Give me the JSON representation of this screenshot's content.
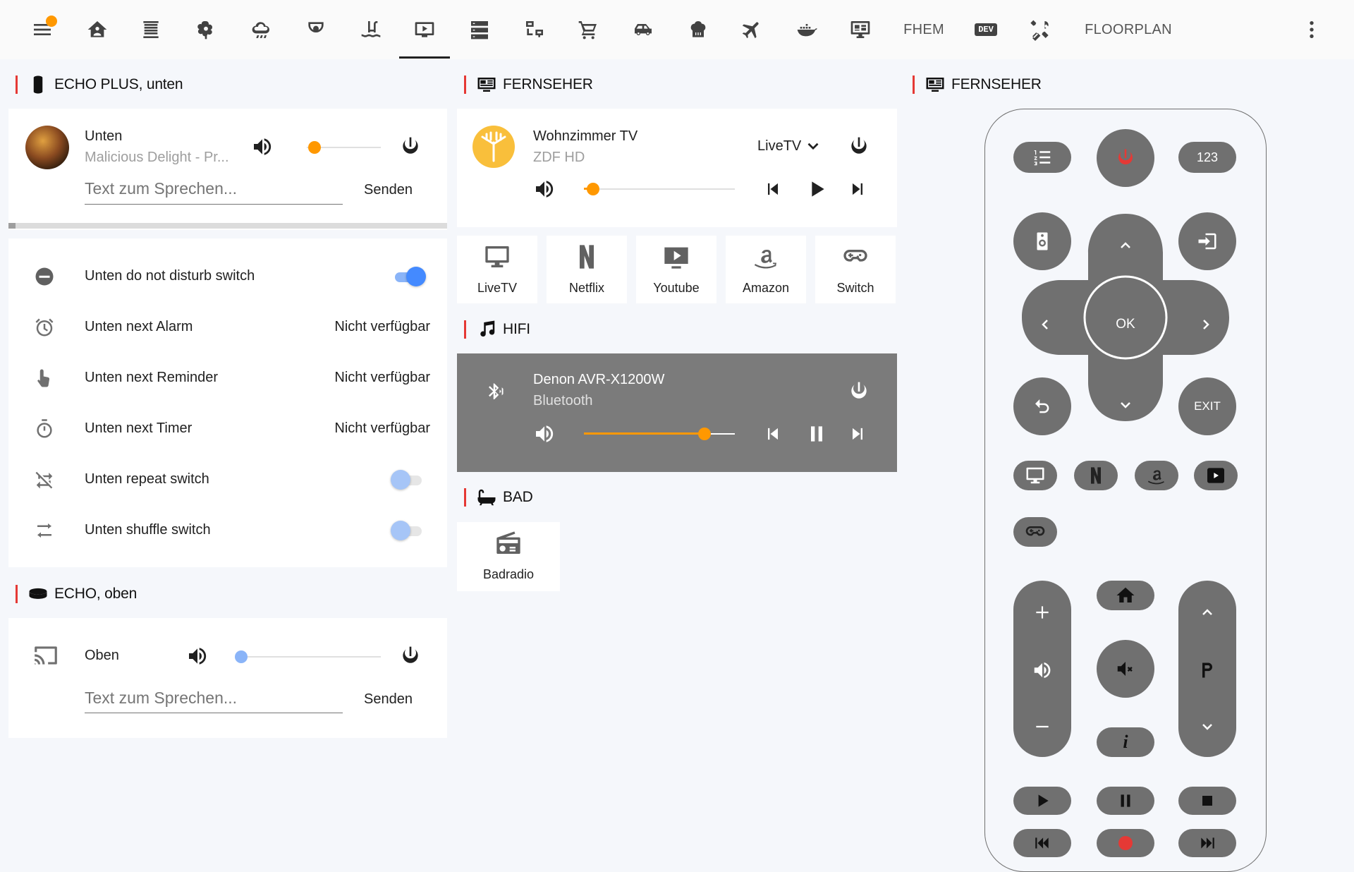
{
  "topbar": {
    "icons": [
      "menu-icon",
      "home-account-icon",
      "blinds-icon",
      "flower-icon",
      "weather-icon",
      "security-camera-icon",
      "pool-icon",
      "television-play-icon",
      "server-icon",
      "network-icon",
      "cart-icon",
      "car-icon",
      "chef-hat-icon",
      "airplane-icon",
      "docker-icon",
      "monitor-dashboard-icon"
    ],
    "fhem_label": "FHEM",
    "dev_label": "DEV",
    "floorplan_label": "FLOORPLAN",
    "badge_color": "#ff9800"
  },
  "echo_plus": {
    "title": "ECHO PLUS, unten",
    "player": {
      "name": "Unten",
      "track": "Malicious Delight - Pr...",
      "volume": 0.1,
      "tts_placeholder": "Text zum Sprechen...",
      "send_label": "Senden"
    },
    "entities": [
      {
        "icon": "minus-circle-icon",
        "name": "Unten do not disturb switch",
        "type": "toggle",
        "on": true
      },
      {
        "icon": "alarm-icon",
        "name": "Unten next Alarm",
        "type": "value",
        "value": "Nicht verfügbar"
      },
      {
        "icon": "gesture-tap-icon",
        "name": "Unten next Reminder",
        "type": "value",
        "value": "Nicht verfügbar"
      },
      {
        "icon": "timer-icon",
        "name": "Unten next Timer",
        "type": "value",
        "value": "Nicht verfügbar"
      },
      {
        "icon": "repeat-off-icon",
        "name": "Unten repeat switch",
        "type": "toggle",
        "on": false
      },
      {
        "icon": "shuffle-disabled-icon",
        "name": "Unten shuffle switch",
        "type": "toggle",
        "on": false
      }
    ]
  },
  "echo_oben": {
    "title": "ECHO, oben",
    "player": {
      "name": "Oben",
      "volume": 0.03,
      "tts_placeholder": "Text zum Sprechen...",
      "send_label": "Senden"
    }
  },
  "fernseher": {
    "title": "FERNSEHER",
    "player": {
      "name": "Wohnzimmer TV",
      "channel": "ZDF HD",
      "source": "LiveTV",
      "volume": 0.06
    },
    "shortcuts": [
      {
        "icon": "monitor-icon",
        "label": "LiveTV"
      },
      {
        "icon": "netflix-icon",
        "label": "Netflix"
      },
      {
        "icon": "youtube-icon",
        "label": "Youtube"
      },
      {
        "icon": "amazon-icon",
        "label": "Amazon"
      },
      {
        "icon": "gamepad-icon",
        "label": "Switch"
      }
    ]
  },
  "hifi": {
    "title": "HIFI",
    "player": {
      "name": "Denon AVR-X1200W",
      "source": "Bluetooth",
      "volume": 0.8
    }
  },
  "bad": {
    "title": "BAD",
    "shortcut_label": "Badradio"
  },
  "remote": {
    "title": "FERNSEHER",
    "num_label": "123",
    "ok_label": "OK",
    "exit_label": "EXIT",
    "power_color": "#e53935",
    "accent_color": "#ff9800"
  }
}
